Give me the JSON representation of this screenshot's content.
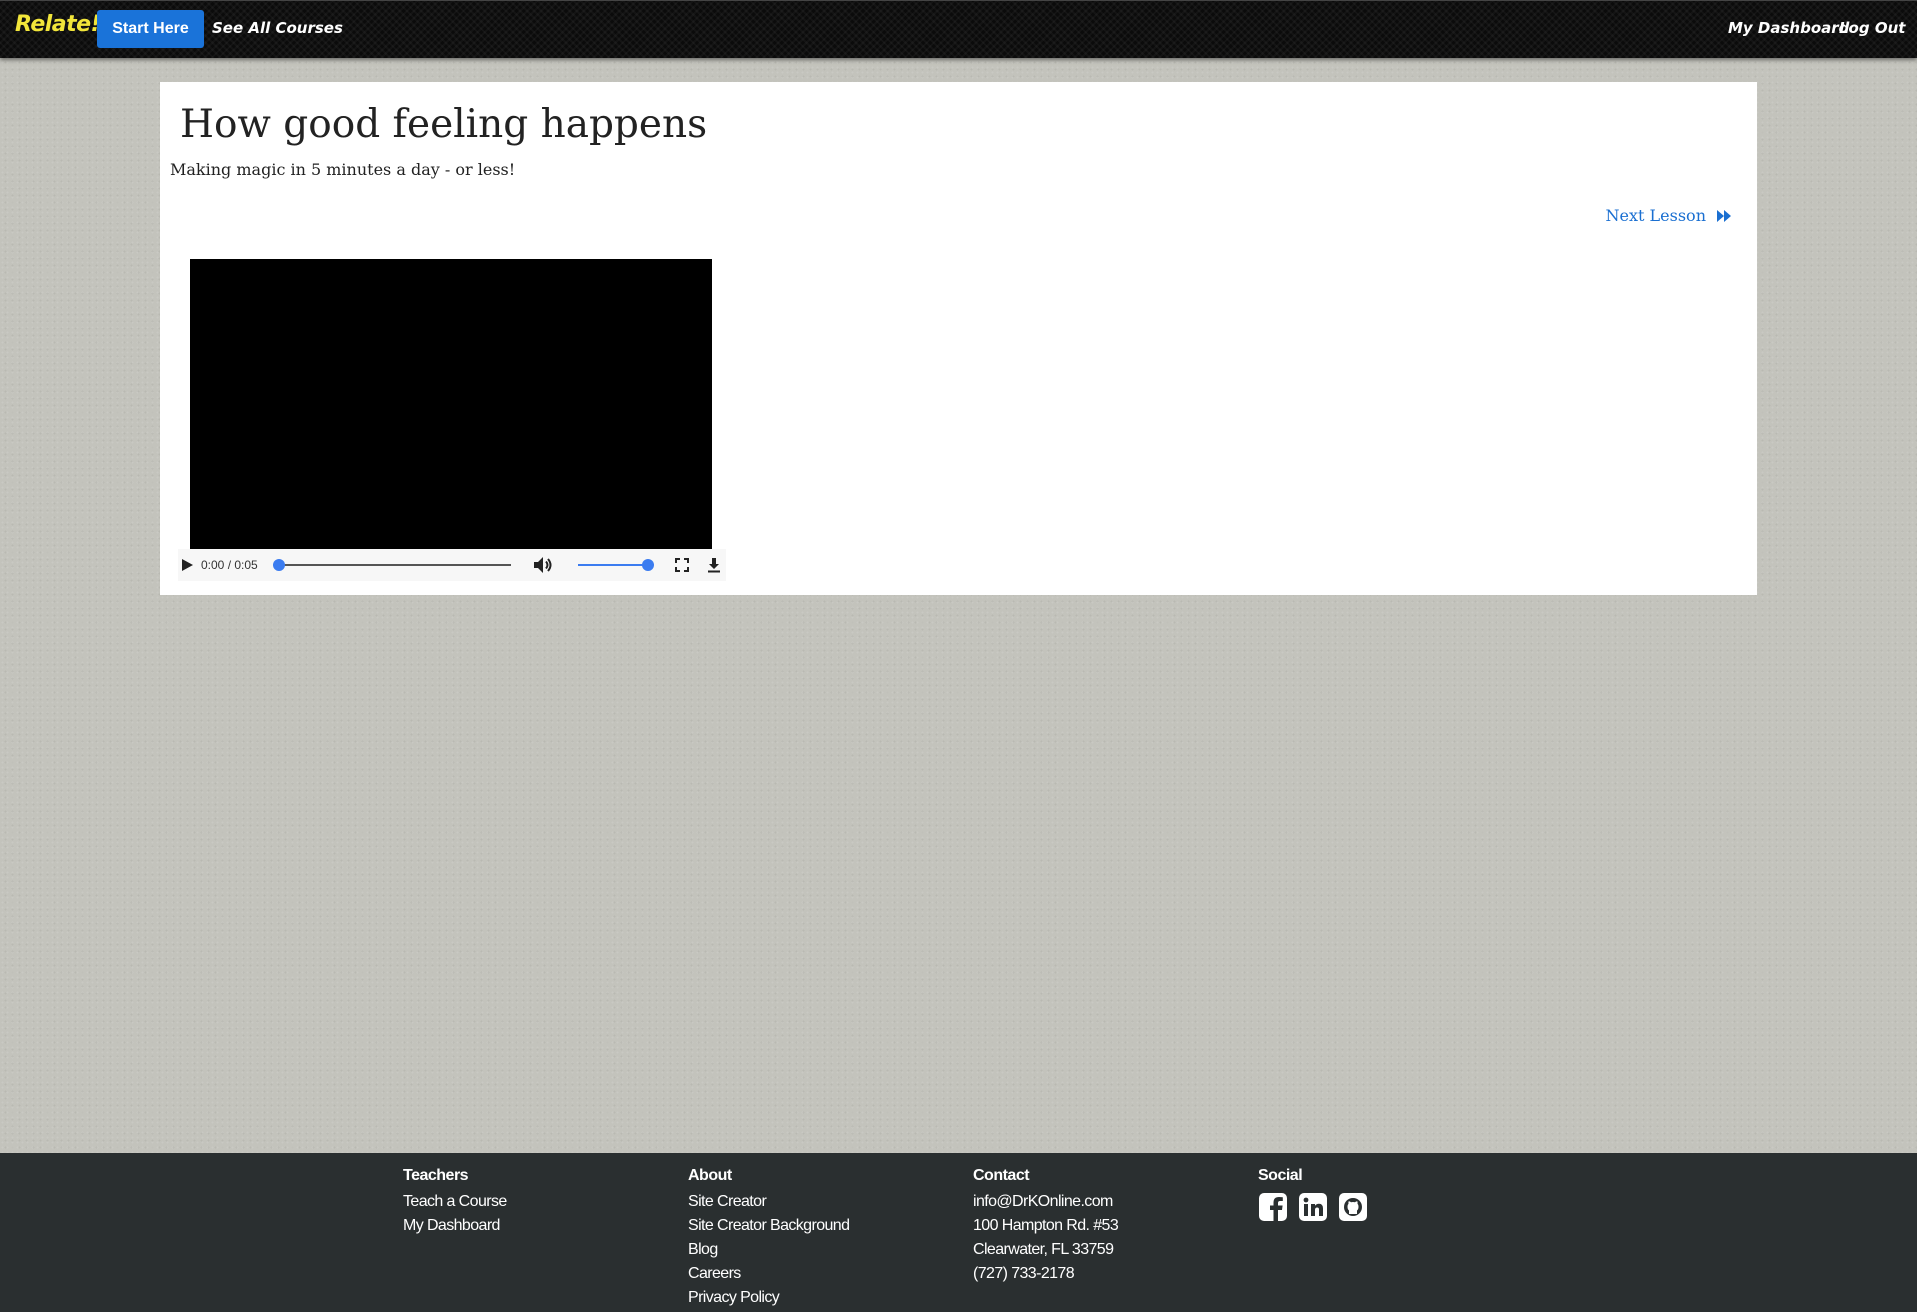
{
  "navbar": {
    "brand": "Relate!",
    "start_button": "Start Here",
    "see_all_courses": "See All Courses",
    "my_dashboard": "My Dashboard",
    "log_out": "Log Out"
  },
  "lesson": {
    "title": "How good feeling happens",
    "subtitle": "Making magic in 5 minutes a day - or less!",
    "next_lesson_label": "Next Lesson"
  },
  "video": {
    "time_display": "0:00 / 0:05",
    "progress_fraction": 0,
    "volume_fraction": 1
  },
  "footer": {
    "teachers": {
      "heading": "Teachers",
      "items": [
        "Teach a Course",
        "My Dashboard"
      ]
    },
    "about": {
      "heading": "About",
      "items": [
        "Site Creator",
        "Site Creator Background",
        "Blog",
        "Careers",
        "Privacy Policy"
      ]
    },
    "contact": {
      "heading": "Contact",
      "items": [
        "info@DrKOnline.com",
        "100 Hampton Rd. #53",
        "Clearwater, FL 33759",
        "(727) 733-2178"
      ]
    },
    "social": {
      "heading": "Social",
      "icons": [
        "facebook-icon",
        "linkedin-icon",
        "github-icon"
      ]
    }
  },
  "colors": {
    "brand": "#f2e63a",
    "primary_button": "#1a73d9",
    "link": "#1a6fd1",
    "footer_background": "#2a2f30",
    "player_accent": "#3b7cf0"
  }
}
